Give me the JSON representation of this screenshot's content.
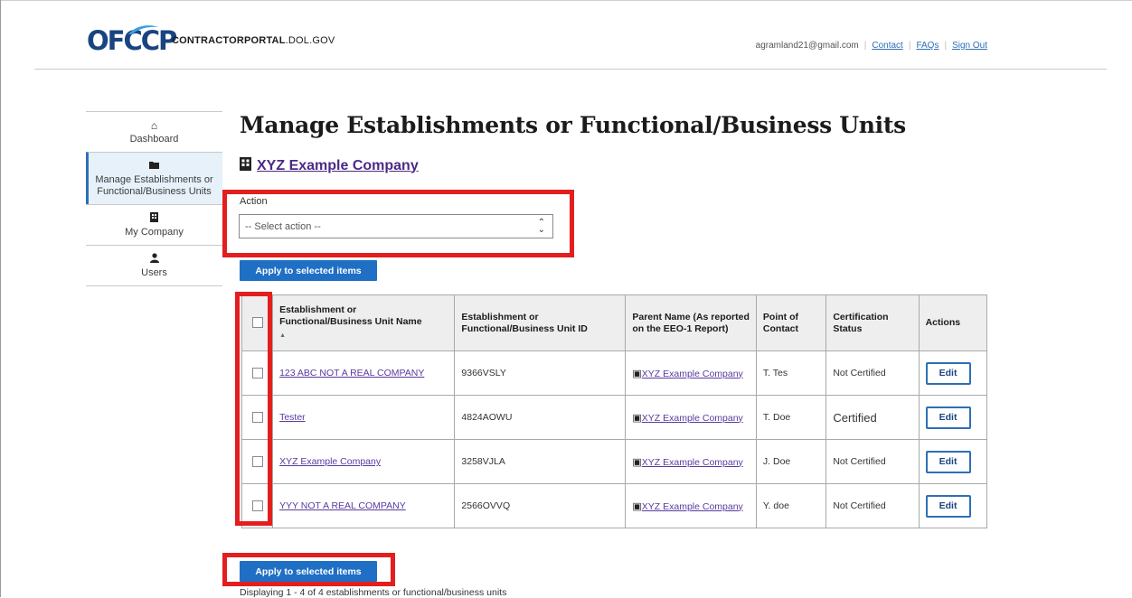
{
  "header": {
    "logo_text": "OFCCP",
    "site_name_bold": "CONTRACTORPORTAL",
    "site_name_rest": ".DOL.GOV",
    "email": "agramland21@gmail.com",
    "links": [
      "Contact",
      "FAQs",
      "Sign Out"
    ]
  },
  "sidebar": {
    "items": [
      {
        "label": "Dashboard",
        "icon": "home-icon",
        "glyph": "🏠"
      },
      {
        "label": "Manage Establishments or Functional/Business Units",
        "icon": "folder-icon",
        "glyph": "📂"
      },
      {
        "label": "My Company",
        "icon": "building-icon",
        "glyph": "🏢"
      },
      {
        "label": "Users",
        "icon": "user-icon",
        "glyph": "👤"
      }
    ]
  },
  "main": {
    "title": "Manage Establishments or Functional/Business Units",
    "company": "XYZ Example Company",
    "action_label": "Action",
    "select_value": "-- Select action --",
    "apply_label": "Apply to selected items",
    "footer": "Displaying 1 - 4 of 4 establishments or functional/business units"
  },
  "table": {
    "headers": [
      "Establishment or Functional/Business Unit Name",
      "Establishment or Functional/Business Unit ID",
      "Parent Name (As reported on the EEO-1 Report)",
      "Point of Contact",
      "Certification Status",
      "Actions"
    ],
    "rows": [
      {
        "name": "123 ABC NOT A REAL COMPANY",
        "id": "9366VSLY",
        "parent": "XYZ Example Company",
        "contact": "T. Tes",
        "status": "Not Certified",
        "action": "Edit"
      },
      {
        "name": "Tester",
        "id": "4824AOWU",
        "parent": "XYZ Example Company",
        "contact": "T. Doe",
        "status": "Certified",
        "action": "Edit"
      },
      {
        "name": "XYZ Example Company",
        "id": "3258VJLA",
        "parent": "XYZ Example Company",
        "contact": "J. Doe",
        "status": "Not Certified",
        "action": "Edit"
      },
      {
        "name": "YYY NOT A REAL COMPANY",
        "id": "2566OVVQ",
        "parent": "XYZ Example Company",
        "contact": "Y. doe",
        "status": "Not Certified",
        "action": "Edit"
      }
    ]
  },
  "colors": {
    "brand": "#1a4480",
    "button": "#1f6fc5",
    "highlight": "#e41e1e",
    "link": "#5a3aa0"
  }
}
